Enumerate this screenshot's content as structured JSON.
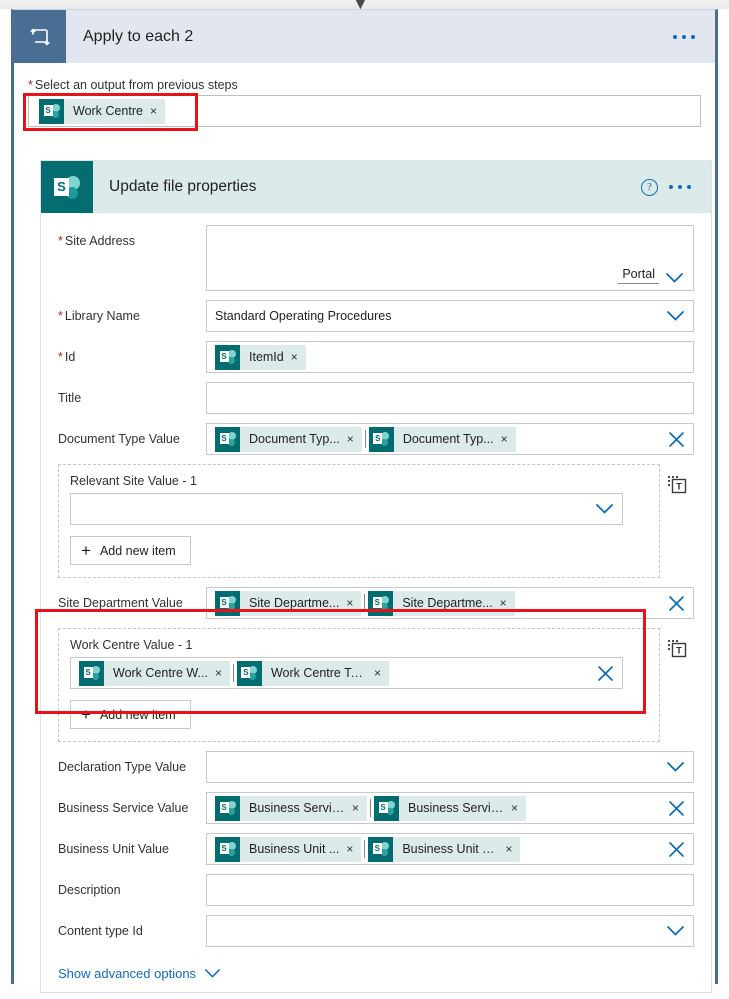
{
  "loop": {
    "icon": "apply-to-each-loop-icon",
    "title": "Apply to each 2",
    "more_label": "...",
    "output_label": "Select an output from previous steps",
    "required_star": "*",
    "output_token": {
      "text": "Work Centre",
      "close": "×",
      "icon": "sharepoint-icon"
    }
  },
  "action": {
    "icon": "sharepoint-icon",
    "title": "Update file properties",
    "help_label": "?",
    "more_label": "...",
    "advanced_link": "Show advanced options"
  },
  "fields": [
    {
      "label": "Site Address",
      "required": true,
      "type": "tall-dropdown",
      "value": "",
      "suffix_text": "Portal"
    },
    {
      "label": "Library Name",
      "required": true,
      "type": "dropdown",
      "value": "Standard Operating Procedures"
    },
    {
      "label": "Id",
      "required": true,
      "type": "tokens",
      "tokens": [
        {
          "text": "ItemId",
          "close": "×"
        }
      ],
      "clear": false
    },
    {
      "label": "Title",
      "required": false,
      "type": "text",
      "value": ""
    },
    {
      "label": "Document Type Value",
      "required": false,
      "type": "tokens",
      "tokens": [
        {
          "text": "Document Typ...",
          "close": "×"
        },
        {
          "text": "Document Typ...",
          "close": "×"
        }
      ],
      "clear": true
    }
  ],
  "repeat_sections": [
    {
      "label": "Relevant Site Value - 1",
      "highlighted": false,
      "field_type": "dropdown",
      "tokens": [],
      "add_label": "Add new item",
      "add_plus": "+",
      "token_icon": "dynamic-content-token-icon"
    },
    {
      "label": "Work Centre Value - 1",
      "highlighted": true,
      "field_type": "tokens",
      "tokens": [
        {
          "text": "Work Centre W...",
          "close": "×"
        },
        {
          "text": "Work Centre Te...",
          "close": "×"
        }
      ],
      "add_label": "Add new item",
      "add_plus": "+",
      "token_icon": "dynamic-content-token-icon"
    }
  ],
  "mid_field": {
    "label": "Site Department Value",
    "type": "tokens",
    "tokens": [
      {
        "text": "Site Departme...",
        "close": "×"
      },
      {
        "text": "Site Departme...",
        "close": "×"
      }
    ],
    "clear": true
  },
  "bottom_fields": [
    {
      "label": "Declaration Type Value",
      "required": false,
      "type": "dropdown",
      "value": ""
    },
    {
      "label": "Business Service Value",
      "required": false,
      "type": "tokens",
      "tokens": [
        {
          "text": "Business Servic...",
          "close": "×"
        },
        {
          "text": "Business Servic...",
          "close": "×"
        }
      ],
      "clear": true
    },
    {
      "label": "Business Unit Value",
      "required": false,
      "type": "tokens",
      "tokens": [
        {
          "text": "Business Unit ...",
          "close": "×"
        },
        {
          "text": "Business Unit T...",
          "close": "×"
        }
      ],
      "clear": true
    },
    {
      "label": "Description",
      "required": false,
      "type": "text",
      "value": ""
    },
    {
      "label": "Content type Id",
      "required": false,
      "type": "dropdown",
      "value": ""
    }
  ],
  "colors": {
    "loop_header_bg": "#e2e7ef",
    "loop_icon_bg": "#4a6d94",
    "sharepoint_teal": "#036c70",
    "sp_header_bg": "#dcebea",
    "accent_blue": "#0f6cbd",
    "required_red": "#a4262c",
    "highlight_red": "#e8121b",
    "chip_bg": "#dcebea"
  }
}
